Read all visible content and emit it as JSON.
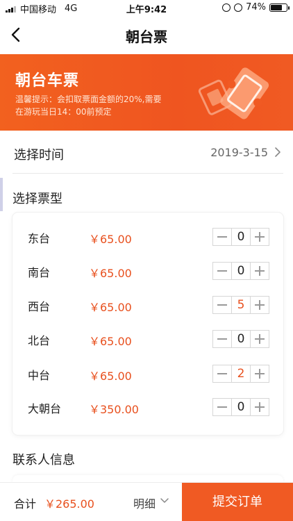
{
  "status_bar": {
    "carrier": "中国移动",
    "network": "4G",
    "time": "上午9:42",
    "battery": "74%",
    "battery_level": 0.74
  },
  "nav": {
    "title": "朝台票",
    "back_icon": "chevron-left-icon"
  },
  "banner": {
    "title": "朝台车票",
    "note_line1": "温馨提示：会扣取票面金额的20%,需要",
    "note_line2": "在游玩当日14：00前预定",
    "icon": "ticket-icon"
  },
  "date_select": {
    "label": "选择时间",
    "value": "2019-3-15"
  },
  "ticket_section": {
    "title": "选择票型",
    "types": [
      {
        "name": "东台",
        "price": "￥65.00",
        "qty": "0"
      },
      {
        "name": "南台",
        "price": "￥65.00",
        "qty": "0"
      },
      {
        "name": "西台",
        "price": "￥65.00",
        "qty": "5"
      },
      {
        "name": "北台",
        "price": "￥65.00",
        "qty": "0"
      },
      {
        "name": "中台",
        "price": "￥65.00",
        "qty": "2"
      },
      {
        "name": "大朝台",
        "price": "￥350.00",
        "qty": "0"
      }
    ]
  },
  "contact_section": {
    "title": "联系人信息"
  },
  "bottom_bar": {
    "total_label": "合计",
    "total_value": "￥265.00",
    "detail_label": "明细",
    "submit_label": "提交订单"
  },
  "colors": {
    "accent": "#f05a23",
    "price": "#e8501e"
  }
}
